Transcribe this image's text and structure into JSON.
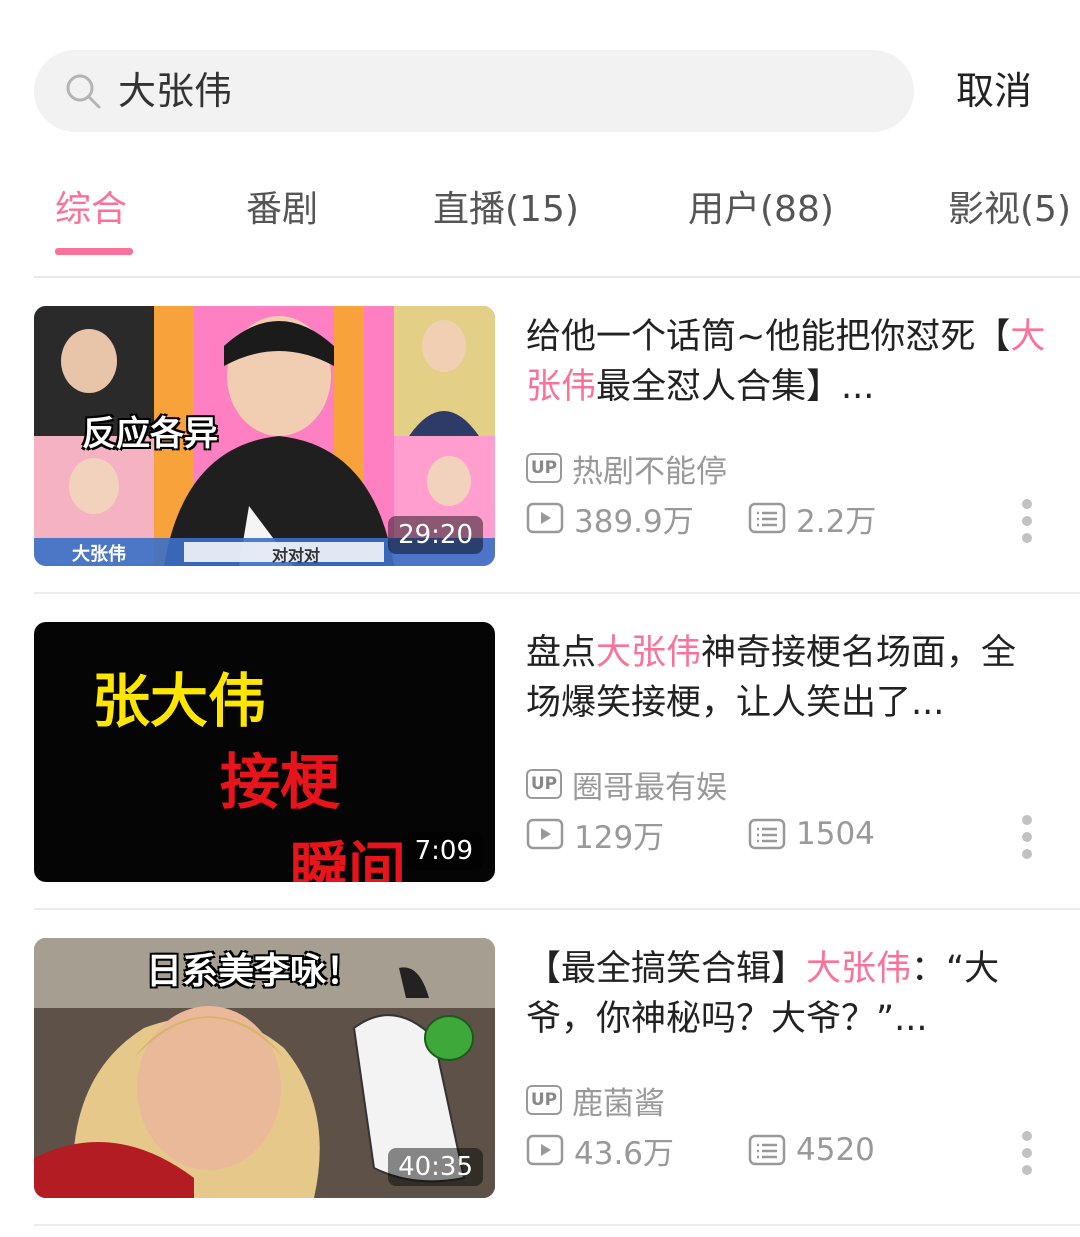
{
  "search": {
    "query": "大张伟",
    "cancel_label": "取消"
  },
  "tabs": [
    {
      "label": "综合",
      "active": true
    },
    {
      "label": "番剧",
      "active": false
    },
    {
      "label": "直播(15)",
      "active": false
    },
    {
      "label": "用户(88)",
      "active": false
    },
    {
      "label": "影视(5)",
      "active": false
    }
  ],
  "colors": {
    "accent": "#fb7299",
    "secondary_text": "#999999"
  },
  "results": [
    {
      "title_before": "给他一个话筒~他能把你怼死【",
      "title_highlight": "大张伟",
      "title_after": "最全怼人合集】...",
      "duration": "29:20",
      "up_badge": "UP",
      "uploader": "热剧不能停",
      "views": "389.9万",
      "comments": "2.2万",
      "thumb_captions": {
        "top": "反应各异",
        "bottom_left": "大张伟",
        "bottom_mid": "对对对"
      }
    },
    {
      "title_before": "盘点",
      "title_highlight": "大张伟",
      "title_after": "神奇接梗名场面，全场爆笑接梗，让人笑出了...",
      "duration": "7:09",
      "up_badge": "UP",
      "uploader": "圈哥最有娱",
      "views": "129万",
      "comments": "1504",
      "thumb_captions": {
        "line1": "张大伟",
        "line2": "接梗",
        "line3": "瞬间"
      }
    },
    {
      "title_before": "【最全搞笑合辑】",
      "title_highlight": "大张伟",
      "title_after": "：“大爷，你神秘吗？大爷？”...",
      "duration": "40:35",
      "up_badge": "UP",
      "uploader": "鹿菌酱",
      "views": "43.6万",
      "comments": "4520",
      "thumb_captions": {
        "top": "日系美李咏！"
      }
    }
  ],
  "icons": [
    "search-icon",
    "up-badge-icon",
    "play-count-icon",
    "comment-count-icon",
    "more-vertical-icon"
  ]
}
